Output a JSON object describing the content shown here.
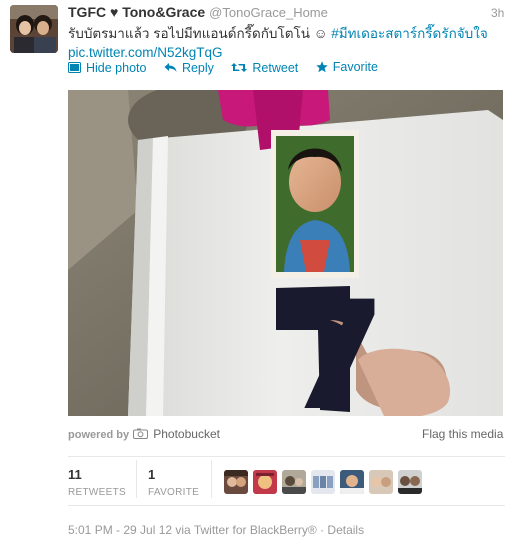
{
  "tweet": {
    "display_name": "TGFC ♥ Tono&Grace",
    "handle": "@TonoGrace_Home",
    "time": "3h",
    "text": "รับบัตรมาแล้ว รอไปมีทแอนด์กรี๊ดกับโตโน่ ☺",
    "hashtag": "#มีทเดอะสตาร์กรี๊ดรักจับใจ",
    "link": "pic.twitter.com/N52kgTqG"
  },
  "actions": {
    "hide_photo": "Hide photo",
    "reply": "Reply",
    "retweet": "Retweet",
    "favorite": "Favorite"
  },
  "media": {
    "card_number": "7",
    "powered_by": "powered by",
    "provider": "Photobucket",
    "flag": "Flag this media"
  },
  "stats": {
    "retweets_count": "11",
    "retweets_label": "RETWEETS",
    "favorites_count": "1",
    "favorites_label": "FAVORITE"
  },
  "footer": {
    "meta": "5:01 PM - 29 Jul 12 via Twitter for BlackBerry®",
    "separator": "·",
    "details": "Details"
  },
  "colors": {
    "link": "#0084b4",
    "muted": "#999999",
    "text": "#333333"
  },
  "icons": [
    "photo-icon",
    "reply-icon",
    "retweet-icon",
    "favorite-star-icon",
    "camera-icon"
  ]
}
